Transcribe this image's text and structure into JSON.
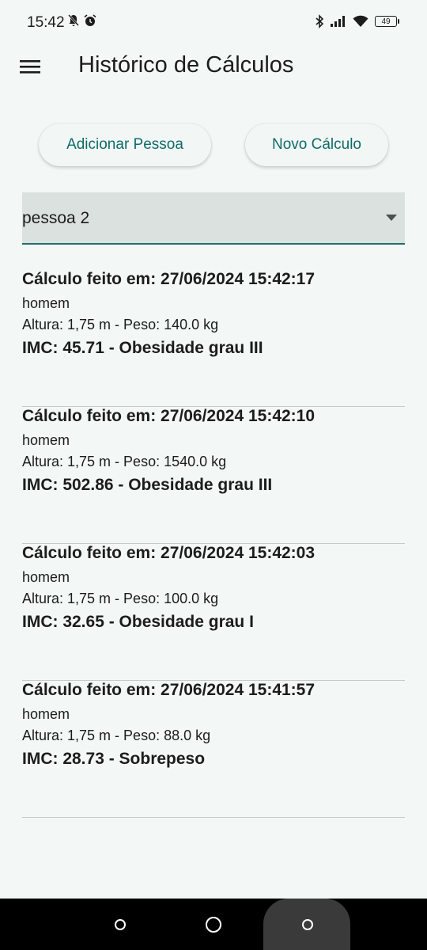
{
  "status_bar": {
    "time": "15:42",
    "battery": "49"
  },
  "header": {
    "title": "Histórico de Cálculos"
  },
  "actions": {
    "add_person": "Adicionar Pessoa",
    "new_calc": "Novo Cálculo"
  },
  "selector": {
    "value": "pessoa 2"
  },
  "history": [
    {
      "title": "Cálculo feito em: 27/06/2024 15:42:17",
      "gender": "homem",
      "detail": "Altura: 1,75 m - Peso: 140.0 kg",
      "imc": "IMC: 45.71 - Obesidade grau III"
    },
    {
      "title": "Cálculo feito em: 27/06/2024 15:42:10",
      "gender": "homem",
      "detail": "Altura: 1,75 m - Peso: 1540.0 kg",
      "imc": "IMC: 502.86 - Obesidade grau III"
    },
    {
      "title": "Cálculo feito em: 27/06/2024 15:42:03",
      "gender": "homem",
      "detail": "Altura: 1,75 m - Peso: 100.0 kg",
      "imc": "IMC: 32.65 - Obesidade grau I"
    },
    {
      "title": "Cálculo feito em: 27/06/2024 15:41:57",
      "gender": "homem",
      "detail": "Altura: 1,75 m - Peso: 88.0 kg",
      "imc": "IMC: 28.73 - Sobrepeso"
    }
  ],
  "icons": {
    "menu": "hamburger-menu-icon",
    "dropdown": "arrow-drop-down-icon"
  },
  "colors": {
    "accent": "#0f6b67",
    "background": "#f3f8f7"
  }
}
